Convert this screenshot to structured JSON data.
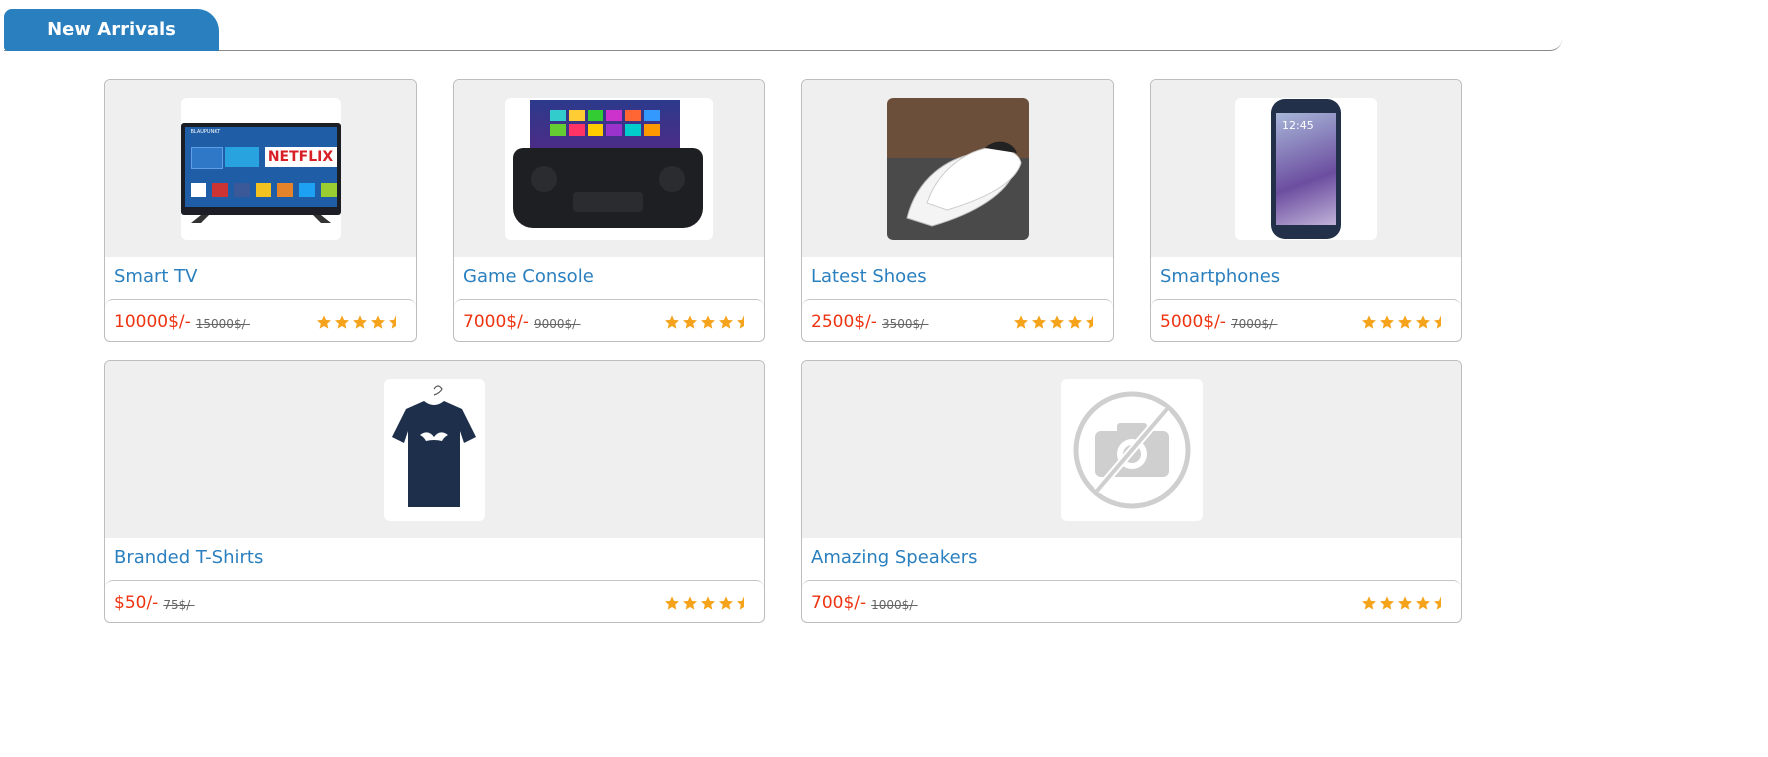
{
  "section": {
    "title": "New Arrivals"
  },
  "products": [
    {
      "name": "Smart TV",
      "price": "10000$/-",
      "old_price": "15000$/-",
      "rating": 4.5,
      "image": "smart-tv-image",
      "screen_brand": "BLAUPUNKT",
      "screen_text": "NETFLIX"
    },
    {
      "name": "Game Console",
      "price": "7000$/-",
      "old_price": "9000$/-",
      "rating": 4.5,
      "image": "game-console-image"
    },
    {
      "name": "Latest Shoes",
      "price": "2500$/-",
      "old_price": "3500$/-",
      "rating": 4.5,
      "image": "shoes-image"
    },
    {
      "name": "Smartphones",
      "price": "5000$/-",
      "old_price": "7000$/-",
      "rating": 4.5,
      "image": "smartphone-image",
      "screen_time": "12:45"
    },
    {
      "name": "Branded T-Shirts",
      "price": "$50/-",
      "old_price": "75$/-",
      "rating": 4.5,
      "image": "tshirt-image"
    },
    {
      "name": "Amazing Speakers",
      "price": "700$/-",
      "old_price": "1000$/-",
      "rating": 4.5,
      "image": "no-image-placeholder"
    }
  ],
  "colors": {
    "accent": "#2a7fbf",
    "price": "#ee3311",
    "star": "#f5a31a",
    "card_image_bg": "#efefef"
  }
}
